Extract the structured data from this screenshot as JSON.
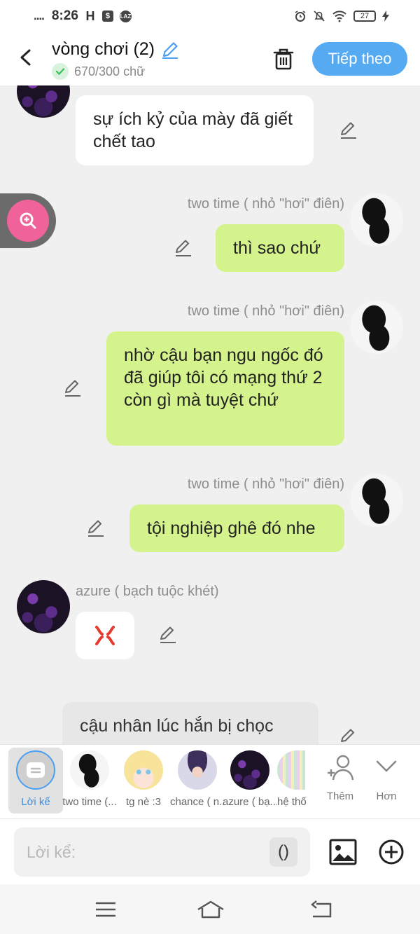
{
  "status_bar": {
    "signal": "....",
    "time": "8:26",
    "app_icon_1": "H",
    "app_icon_2": "$",
    "app_icon_3": "LAZ",
    "battery": "27"
  },
  "header": {
    "title": "vòng chơi (2)",
    "word_count": "670/300 chữ",
    "next_label": "Tiếp theo"
  },
  "messages": [
    {
      "side": "left",
      "speaker": "",
      "text": "sự ích kỷ của mày đã giết chết tao",
      "style": "white"
    },
    {
      "side": "right",
      "speaker": "two time ( nhỏ \"hơi\" điên)",
      "text": "thì sao chứ",
      "style": "green"
    },
    {
      "side": "right",
      "speaker": "two time ( nhỏ \"hơi\" điên)",
      "text": "nhờ cậu bạn ngu ngốc đó đã giúp tôi có mạng thứ 2 còn gì mà tuyệt chứ",
      "style": "green"
    },
    {
      "side": "right",
      "speaker": "two time ( nhỏ \"hơi\" điên)",
      "text": "tội nghiệp ghê đó nhe",
      "style": "green"
    },
    {
      "side": "left",
      "speaker": "azure ( bạch tuộc khét)",
      "text": "",
      "style": "sticker"
    },
    {
      "side": "narration",
      "speaker": "",
      "text": "cậu nhân lúc hắn bị chọc",
      "style": "grey"
    }
  ],
  "characters": [
    {
      "label": "Lời kể",
      "selected": true
    },
    {
      "label": "two time (...",
      "selected": false
    },
    {
      "label": "tg nè :3",
      "selected": false
    },
    {
      "label": "chance ( n...",
      "selected": false
    },
    {
      "label": "azure ( bạ...",
      "selected": false
    },
    {
      "label": "hệ thố",
      "selected": false
    }
  ],
  "strip_actions": {
    "add_label": "Thêm",
    "more_label": "Hơn"
  },
  "input": {
    "placeholder": "Lời kể:",
    "paren_label": "()"
  },
  "colors": {
    "accent_blue": "#55aaf1",
    "green_bubble": "#d4f38c",
    "pink_zoom": "#f0639a"
  }
}
